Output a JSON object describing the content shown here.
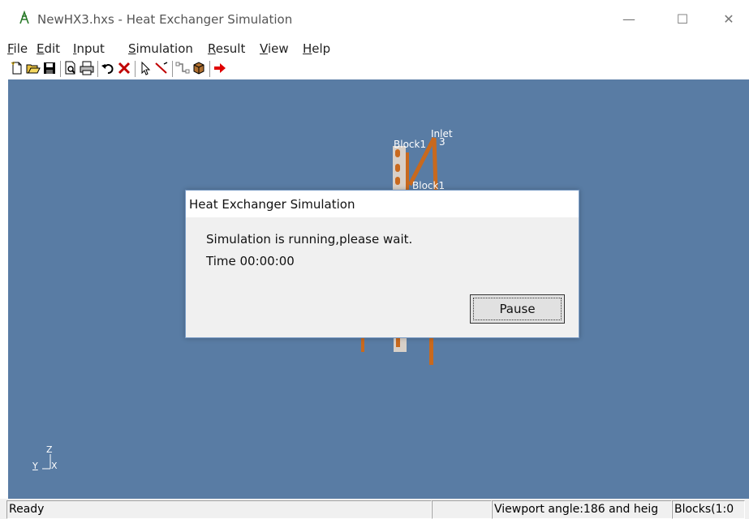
{
  "window": {
    "title": "NewHX3.hxs - Heat Exchanger Simulation",
    "minimize_glyph": "—",
    "maximize_glyph": "☐",
    "close_glyph": "✕"
  },
  "menu": {
    "items": [
      {
        "acc": "F",
        "rest": "ile"
      },
      {
        "acc": "E",
        "rest": "dit"
      },
      {
        "acc": "I",
        "rest": "nput"
      },
      {
        "acc": "S",
        "rest": "imulation"
      },
      {
        "acc": "R",
        "rest": "esult"
      },
      {
        "acc": "V",
        "rest": "iew"
      },
      {
        "acc": "H",
        "rest": "elp"
      }
    ]
  },
  "toolbar": {
    "icons": [
      "new-file-icon",
      "open-folder-icon",
      "save-icon",
      "print-preview-icon",
      "print-icon",
      "undo-icon",
      "delete-icon",
      "select-pointer-icon",
      "draw-line-icon",
      "connect-icon",
      "block-icon",
      "run-arrow-icon"
    ]
  },
  "viewport": {
    "labels": {
      "block1_top": "Block1",
      "inlet": "Inlet",
      "inlet_num": "3",
      "block1_mid": "Block1"
    },
    "axis": {
      "z": "Z",
      "y": "Y",
      "x": "X"
    },
    "background": "#597ca4",
    "pipe_color": "#c8691e"
  },
  "dialog": {
    "title": "Heat Exchanger Simulation",
    "message": "Simulation is running,please wait.",
    "time": "Time 00:00:00",
    "pause_label": "Pause"
  },
  "status": {
    "ready": "Ready",
    "empty": "",
    "viewport_angle": "Viewport angle:186 and heig",
    "blocks": "Blocks(1:0"
  }
}
